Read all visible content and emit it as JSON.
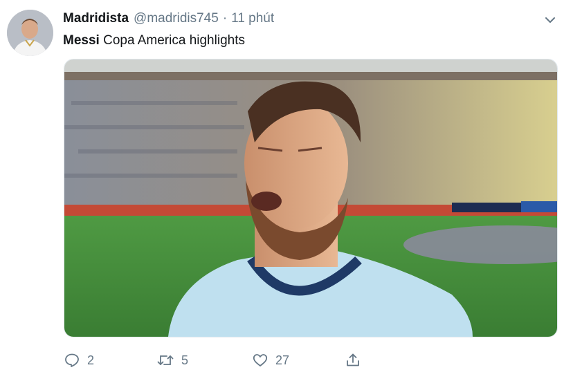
{
  "tweet": {
    "author_name": "Madridista",
    "handle": "@madridis745",
    "separator": "·",
    "time": "11 phút",
    "text_bold": "Messi",
    "text_rest": " Copa America highlights"
  },
  "stats": {
    "replies": "2",
    "retweets": "5",
    "likes": "27"
  },
  "icons": {
    "more": "chevron-down-icon",
    "reply": "reply-icon",
    "retweet": "retweet-icon",
    "like": "heart-icon",
    "share": "share-icon"
  },
  "colors": {
    "text": "#14171a",
    "secondary": "#657786",
    "pitch": "#3f8a3a"
  }
}
